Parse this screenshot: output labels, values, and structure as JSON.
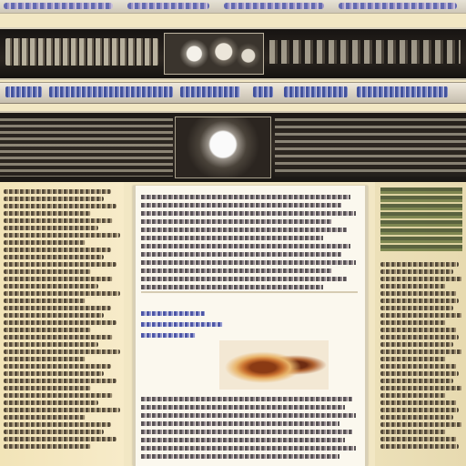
{
  "colors": {
    "page_background": "#f2e7c4",
    "header_dark": "#1d1916",
    "nav_link": "#283c96",
    "article_background": "#fbf8ee"
  },
  "icons": {
    "header_emblem": "emblem-icon",
    "center_emblem": "crest-icon"
  },
  "text_legibility": "illegible"
}
